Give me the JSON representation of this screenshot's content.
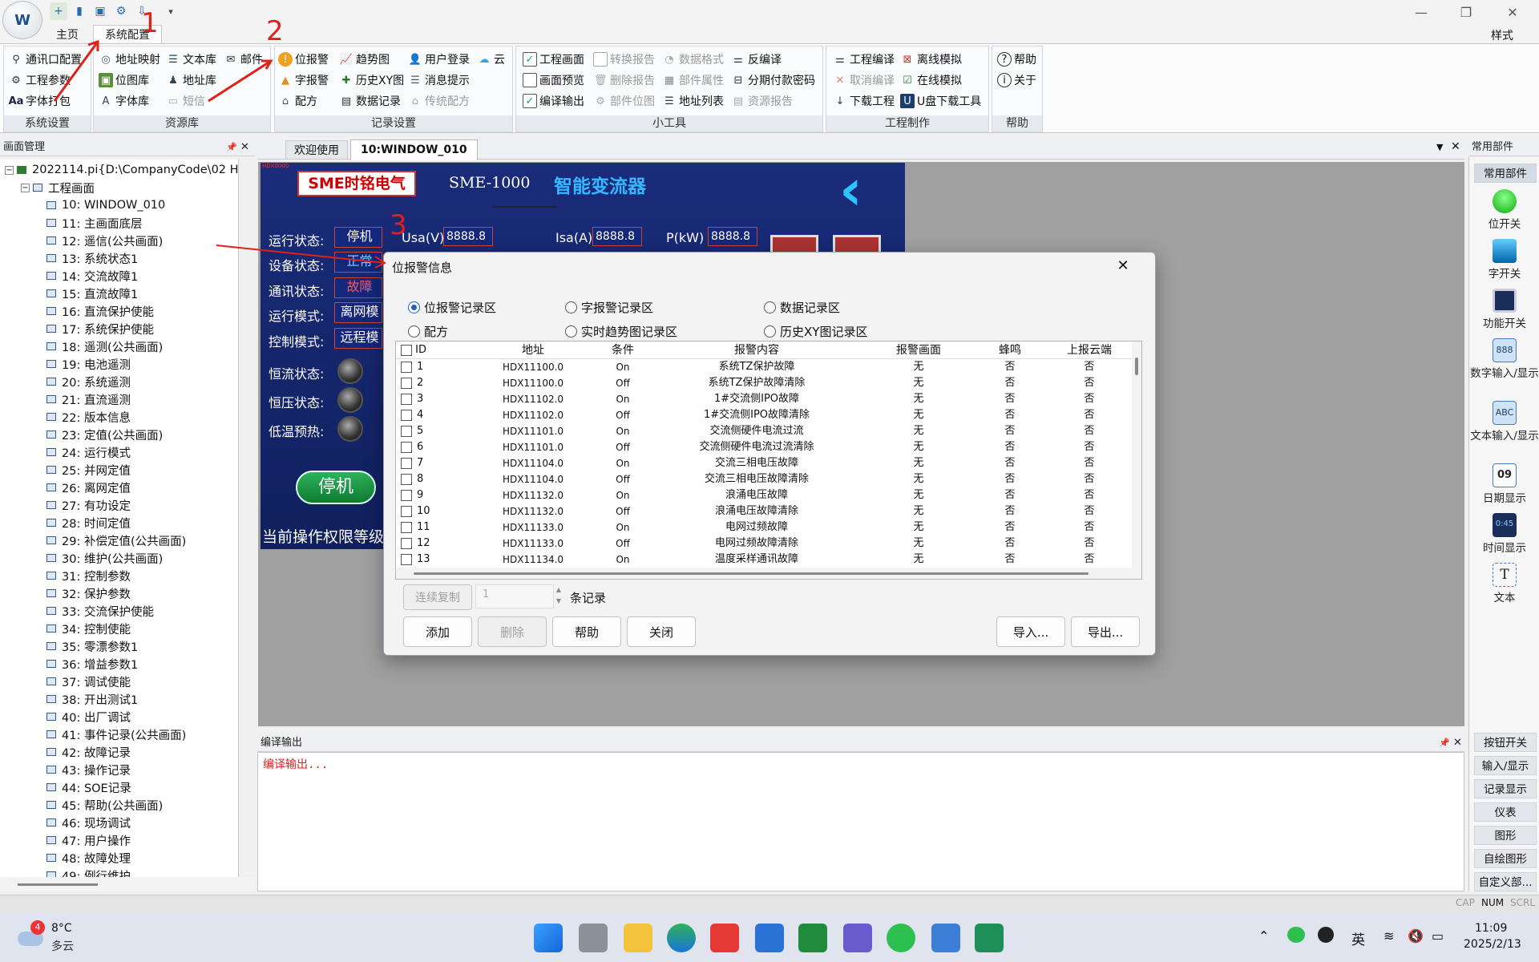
{
  "app": {
    "style_label": "样式"
  },
  "ribbon_tabs": [
    "主页",
    "系统配置"
  ],
  "ribbon": {
    "groups": [
      {
        "label": "系统设置",
        "items": [
          "通讯口配置",
          "工程参数",
          "字体打包"
        ]
      },
      {
        "label": "资源库",
        "items": [
          "地址映射",
          "文本库",
          "邮件",
          "位图库",
          "地址库",
          "字体库",
          "短信"
        ]
      },
      {
        "label": "记录设置",
        "items": [
          "位报警",
          "趋势图",
          "用户登录",
          "云",
          "字报警",
          "历史XY图",
          "消息提示",
          "配方",
          "数据记录",
          "传统配方"
        ]
      },
      {
        "label": "小工具",
        "items": [
          "工程画面",
          "转换报告",
          "数据格式",
          "反编译",
          "画面预览",
          "删除报告",
          "部件属性",
          "分期付款密码",
          "编译输出",
          "部件位图",
          "地址列表",
          "资源报告"
        ]
      },
      {
        "label": "工程制作",
        "items": [
          "工程编译",
          "离线模拟",
          "取消编译",
          "在线模拟",
          "下载工程",
          "U盘下载工具"
        ]
      },
      {
        "label": "帮助",
        "items": [
          "帮助",
          "关于"
        ]
      }
    ]
  },
  "left_panel": {
    "title": "画面管理",
    "root": "2022114.pi{D:\\CompanyCode\\02 H",
    "folder": "工程画面",
    "items": [
      "10: WINDOW_010",
      "11: 主画面底层",
      "12: 遥信(公共画面)",
      "13: 系统状态1",
      "14: 交流故障1",
      "15: 直流故障1",
      "16: 直流保护使能",
      "17: 系统保护使能",
      "18: 遥测(公共画面)",
      "19: 电池遥测",
      "20: 系统遥测",
      "21: 直流遥测",
      "22: 版本信息",
      "23: 定值(公共画面)",
      "24: 运行模式",
      "25: 并网定值",
      "26: 离网定值",
      "27: 有功设定",
      "28: 时间定值",
      "29: 补偿定值(公共画面)",
      "30: 维护(公共画面)",
      "31: 控制参数",
      "32: 保护参数",
      "33: 交流保护使能",
      "34: 控制使能",
      "35: 零漂参数1",
      "36: 增益参数1",
      "37: 调试使能",
      "38: 开出测试1",
      "40: 出厂调试",
      "41: 事件记录(公共画面)",
      "42: 故障记录",
      "43: 操作记录",
      "44: SOE记录",
      "45: 帮助(公共画面)",
      "46: 现场调试",
      "47: 用户操作",
      "48: 故障处理",
      "49: 例行维护"
    ]
  },
  "doc_tabs": [
    "欢迎使用",
    "10:WINDOW_010"
  ],
  "hmi": {
    "logo": "SME时铭电气",
    "model": "SME-1000",
    "title": "智能变流器",
    "labels": [
      "运行状态:",
      "设备状态:",
      "通讯状态:",
      "运行模式:",
      "控制模式:",
      "恒流状态:",
      "恒压状态:",
      "低温预热:"
    ],
    "box_values": [
      "停机",
      "正常",
      "故障",
      "离网模",
      "远程模"
    ],
    "meters": [
      {
        "label": "Usa(V)",
        "value": "8888.8"
      },
      {
        "label": "Isa(A)",
        "value": "8888.8"
      },
      {
        "label": "P(kW)",
        "value": "8888.8"
      }
    ],
    "stop_button": "停机",
    "footer": "当前操作权限等级",
    "address_tag": "HDX0000"
  },
  "right_panel": {
    "title": "常用部件",
    "header": "常用部件",
    "items": [
      "位开关",
      "字开关",
      "功能开关",
      "数字输入/显示",
      "文本输入/显示",
      "日期显示",
      "时间显示",
      "文本"
    ],
    "icon_texts": {
      "date": "09",
      "time": "0:45",
      "number": "888",
      "text_input": "ABC",
      "text": "T"
    },
    "categories": [
      "按钮开关",
      "输入/显示",
      "记录显示",
      "仪表",
      "图形",
      "自绘图形",
      "自定义部..."
    ]
  },
  "output_panel": {
    "title": "编译输出",
    "text": "编译输出..."
  },
  "statusbar": {
    "indicators": [
      "CAP",
      "NUM",
      "SCRL"
    ]
  },
  "dialog": {
    "title": "位报警信息",
    "radios": [
      "位报警记录区",
      "字报警记录区",
      "数据记录区",
      "配方",
      "实时趋势图记录区",
      "历史XY图记录区"
    ],
    "selected_radio": "位报警记录区",
    "columns": [
      "ID",
      "地址",
      "条件",
      "报警内容",
      "报警画面",
      "蜂鸣",
      "上报云端"
    ],
    "rows": [
      [
        "1",
        "HDX11100.0",
        "On",
        "系统TZ保护故障",
        "无",
        "否",
        "否"
      ],
      [
        "2",
        "HDX11100.0",
        "Off",
        "系统TZ保护故障清除",
        "无",
        "否",
        "否"
      ],
      [
        "3",
        "HDX11102.0",
        "On",
        "1#交流侧IPO故障",
        "无",
        "否",
        "否"
      ],
      [
        "4",
        "HDX11102.0",
        "Off",
        "1#交流侧IPO故障清除",
        "无",
        "否",
        "否"
      ],
      [
        "5",
        "HDX11101.0",
        "On",
        "交流侧硬件电流过流",
        "无",
        "否",
        "否"
      ],
      [
        "6",
        "HDX11101.0",
        "Off",
        "交流侧硬件电流过流清除",
        "无",
        "否",
        "否"
      ],
      [
        "7",
        "HDX11104.0",
        "On",
        "交流三相电压故障",
        "无",
        "否",
        "否"
      ],
      [
        "8",
        "HDX11104.0",
        "Off",
        "交流三相电压故障清除",
        "无",
        "否",
        "否"
      ],
      [
        "9",
        "HDX11132.0",
        "On",
        "浪涌电压故障",
        "无",
        "否",
        "否"
      ],
      [
        "10",
        "HDX11132.0",
        "Off",
        "浪涌电压故障清除",
        "无",
        "否",
        "否"
      ],
      [
        "11",
        "HDX11133.0",
        "On",
        "电网过频故障",
        "无",
        "否",
        "否"
      ],
      [
        "12",
        "HDX11133.0",
        "Off",
        "电网过频故障清除",
        "无",
        "否",
        "否"
      ],
      [
        "13",
        "HDX11134.0",
        "On",
        "温度采样通讯故障",
        "无",
        "否",
        "否"
      ]
    ],
    "copy_button": "连续复制",
    "copy_count": "1",
    "copy_unit": "条记录",
    "buttons": {
      "add": "添加",
      "delete": "删除",
      "help": "帮助",
      "close": "关闭",
      "import": "导入...",
      "export": "导出..."
    }
  },
  "annotations": [
    "1",
    "2",
    "3"
  ],
  "taskbar": {
    "weather_badge": "4",
    "temperature": "8°C",
    "weather": "多云",
    "ime": "英",
    "time": "11:09",
    "date": "2025/2/13"
  }
}
